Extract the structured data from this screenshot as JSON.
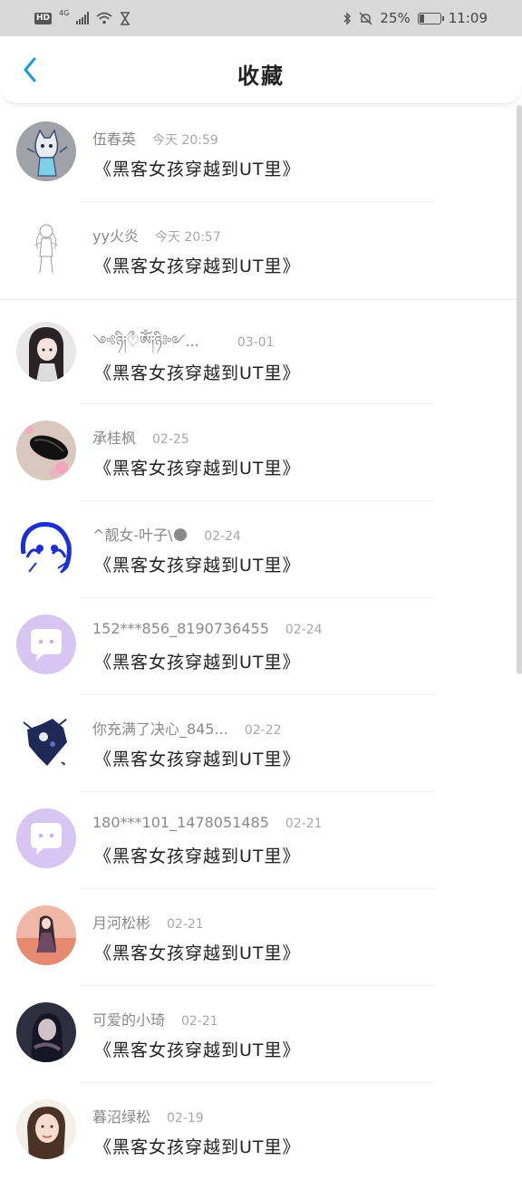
{
  "status_bar": {
    "hd": "HD",
    "network": "4G",
    "battery_text": "25%",
    "battery_level": 0.25,
    "time": "11:09"
  },
  "header": {
    "title": "收藏",
    "back_icon": "chevron-left-icon",
    "accent_color": "#1a9be0"
  },
  "favorites": [
    {
      "username": "伍春英",
      "time": "今天 20:59",
      "title": "《黑客女孩穿越到UT里》",
      "avatar": "cat-drawing"
    },
    {
      "username": "yy火炎",
      "time": "今天 20:57",
      "title": "《黑客女孩穿越到UT里》",
      "avatar": "sketch-figure"
    },
    {
      "username": "༺ཉི༏ྀ♡ༀ༏ཉི༻...",
      "time": "03-01",
      "title": "《黑客女孩穿越到UT里》",
      "avatar": "anime-girl-dark-hair"
    },
    {
      "username": "承桂枫",
      "time": "02-25",
      "title": "《黑客女孩穿越到UT里》",
      "avatar": "mouse-flowers"
    },
    {
      "username": "^靓女-叶子\\🌑",
      "time": "02-24",
      "title": "《黑客女孩穿越到UT里》",
      "avatar": "blue-anime"
    },
    {
      "username": "152***856_8190736455",
      "time": "02-24",
      "title": "《黑客女孩穿越到UT里》",
      "avatar": "default-chat"
    },
    {
      "username": "你充满了决心_845...",
      "time": "02-22",
      "title": "《黑客女孩穿越到UT里》",
      "avatar": "dark-character"
    },
    {
      "username": "180***101_1478051485",
      "time": "02-21",
      "title": "《黑客女孩穿越到UT里》",
      "avatar": "default-chat"
    },
    {
      "username": "月河松彬",
      "time": "02-21",
      "title": "《黑客女孩穿越到UT里》",
      "avatar": "sunset-girl"
    },
    {
      "username": "可爱的小琦",
      "time": "02-21",
      "title": "《黑客女孩穿越到UT里》",
      "avatar": "dark-anime"
    },
    {
      "username": "暮沼绿松",
      "time": "02-19",
      "title": "《黑客女孩穿越到UT里》",
      "avatar": "photo-girl"
    }
  ]
}
